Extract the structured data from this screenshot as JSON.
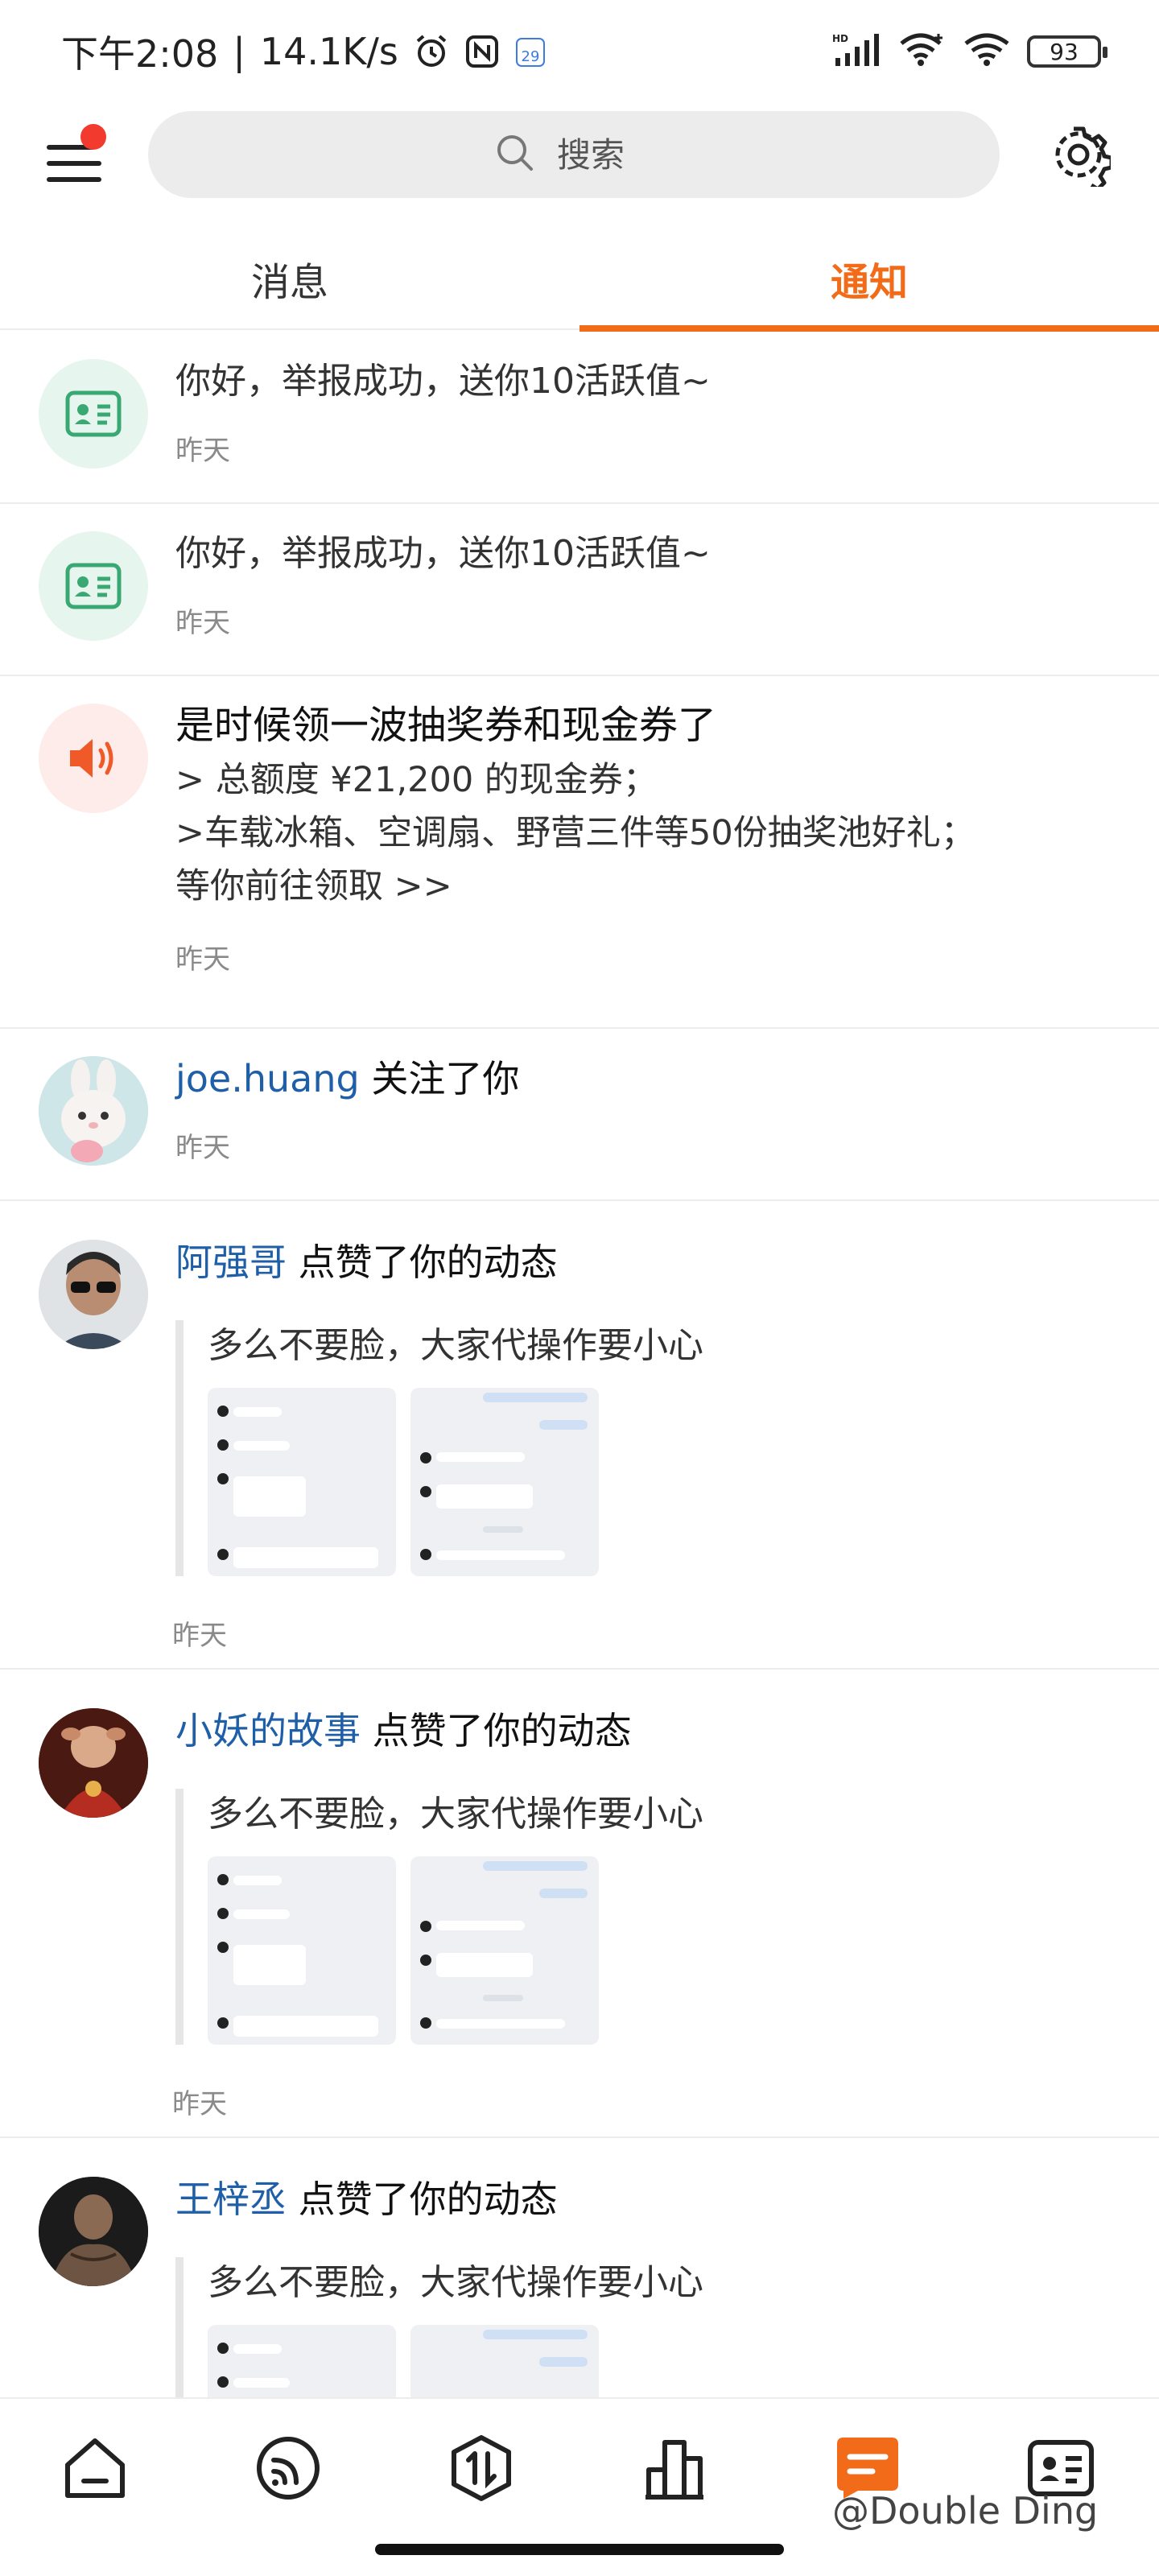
{
  "status_bar": {
    "time": "下午2:08",
    "separator": "|",
    "speed": "14.1K/s",
    "date_badge": "29",
    "battery": "93"
  },
  "header": {
    "search_placeholder": "搜索"
  },
  "tabs": [
    {
      "label": "消息",
      "active": false
    },
    {
      "label": "通知",
      "active": true
    }
  ],
  "notifications": [
    {
      "type": "system",
      "icon": "id-card-icon",
      "text": "你好，举报成功，送你10活跃值~",
      "time": "昨天"
    },
    {
      "type": "system",
      "icon": "id-card-icon",
      "text": "你好，举报成功，送你10活跃值~",
      "time": "昨天"
    },
    {
      "type": "announcement",
      "icon": "speaker-icon",
      "title": "是时候领一波抽奖券和现金券了",
      "lines": [
        "> 总额度 ¥21,200 的现金券；",
        ">车载冰箱、空调扇、野营三件等50份抽奖池好礼；",
        "等你前往领取 >>"
      ],
      "time": "昨天"
    },
    {
      "type": "follow",
      "user": "joe.huang",
      "action": " 关注了你",
      "time": "昨天"
    },
    {
      "type": "like",
      "user": "阿强哥",
      "action": " 点赞了你的动态",
      "quote": "多么不要脸，大家代操作要小心",
      "time": "昨天"
    },
    {
      "type": "like",
      "user": "小妖的故事",
      "action": " 点赞了你的动态",
      "quote": "多么不要脸，大家代操作要小心",
      "time": "昨天"
    },
    {
      "type": "like",
      "user": "王梓丞",
      "action": " 点赞了你的动态",
      "quote": "多么不要脸，大家代操作要小心"
    }
  ],
  "bottom_nav": [
    {
      "icon": "home-icon",
      "active": false
    },
    {
      "icon": "feed-icon",
      "active": false
    },
    {
      "icon": "exchange-icon",
      "active": false
    },
    {
      "icon": "ranking-icon",
      "active": false
    },
    {
      "icon": "message-icon",
      "active": true
    },
    {
      "icon": "profile-card-icon",
      "active": false
    }
  ],
  "watermark": "@Double Ding",
  "colors": {
    "accent": "#f26b18",
    "link": "#1f5fa8",
    "icon_green": "#3aa873",
    "icon_orange": "#f05a28"
  }
}
